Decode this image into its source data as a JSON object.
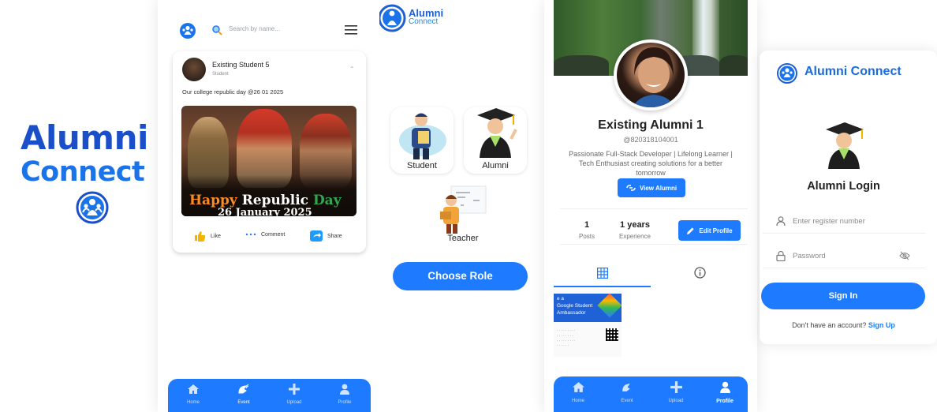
{
  "brand": {
    "word1": "Alumni",
    "word2": "Connect"
  },
  "feed": {
    "search_placeholder": "Search by name...",
    "post": {
      "author": "Existing Student 5",
      "role": "Student",
      "text": "Our college republic day @26 01 2025",
      "image_text": {
        "happy": "Happy",
        "republic": "Republic",
        "day": "Day",
        "date": "26 January 2025"
      },
      "actions": [
        "Like",
        "Comment",
        "Share"
      ]
    },
    "nav": [
      "Home",
      "Event",
      "Upload",
      "Profile"
    ],
    "active_nav": "Event"
  },
  "roles": {
    "app_title_1": "Alumni",
    "app_title_2": "Connect",
    "options": [
      "Student",
      "Alumni",
      "Teacher"
    ],
    "choose_button": "Choose Role"
  },
  "profile": {
    "name": "Existing Alumni 1",
    "handle": "@820318104001",
    "bio": "Passionate Full-Stack Developer | Lifelong Learner | Tech Enthusiast creating solutions for a better tomorrow",
    "view_button": "View Alumni",
    "stats": [
      {
        "value": "1",
        "label": "Posts"
      },
      {
        "value": "1 years",
        "label": "Experience"
      }
    ],
    "edit_button": "Edit Profile",
    "thumb_text": [
      "e a",
      "Google Student",
      "Ambassador"
    ],
    "nav": [
      "Home",
      "Event",
      "Upload",
      "Profile"
    ],
    "active_nav": "Profile"
  },
  "login": {
    "brand": "Alumni Connect",
    "title": "Alumni Login",
    "register_placeholder": "Enter register number",
    "password_placeholder": "Password",
    "signin_button": "Sign In",
    "signup_prompt": "Don't have an account?",
    "signup_link": "Sign Up"
  },
  "colors": {
    "primary": "#1e7bff",
    "brand_dark": "#1b4fc9",
    "brand_light": "#1a73e8"
  }
}
